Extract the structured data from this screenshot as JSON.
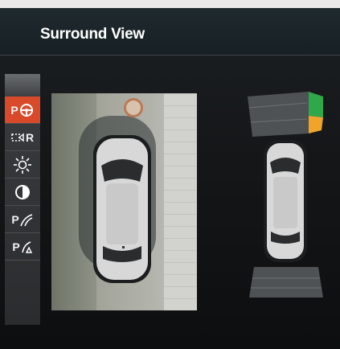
{
  "header": {
    "title": "Surround View"
  },
  "sidebar": {
    "items": [
      {
        "label": "P",
        "icon": "park-assist-steering-icon",
        "active": true
      },
      {
        "label": "R",
        "icon": "reverse-camera-icon",
        "active": false
      },
      {
        "label": "",
        "icon": "brightness-icon",
        "active": false
      },
      {
        "label": "",
        "icon": "contrast-icon",
        "active": false
      },
      {
        "label": "P",
        "icon": "parking-lines-icon",
        "active": false
      },
      {
        "label": "P",
        "icon": "obstacle-view-icon",
        "active": false
      }
    ]
  },
  "camera_view": {
    "icon": "top-down-camera-car"
  },
  "distance_overview": {
    "front_right_sensor": [
      "green",
      "orange"
    ],
    "colors": {
      "green": "#2fa84a",
      "orange": "#f0a42a",
      "accent": "#d94a2b"
    }
  }
}
